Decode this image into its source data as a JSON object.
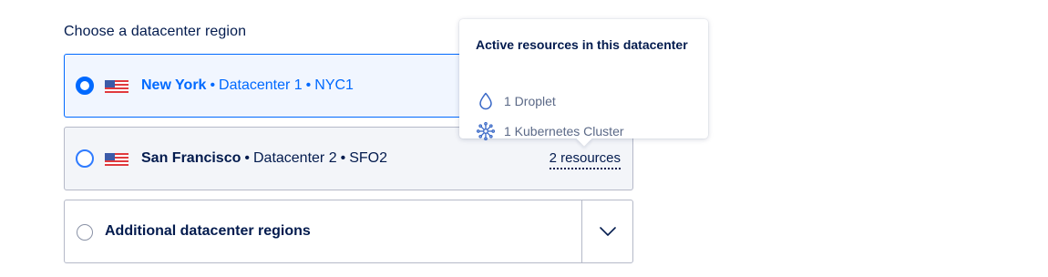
{
  "heading": "Choose a datacenter region",
  "regions": [
    {
      "city": "New York",
      "datacenter": "Datacenter 1",
      "code": "NYC1",
      "selected": true
    },
    {
      "city": "San Francisco",
      "datacenter": "Datacenter 2",
      "code": "SFO2",
      "selected": false,
      "resources_link": "2 resources"
    }
  ],
  "separator": "•",
  "additional": {
    "label": "Additional datacenter regions"
  },
  "tooltip": {
    "title": "Active resources in this datacenter",
    "items": [
      {
        "icon": "droplet-icon",
        "label": "1 Droplet"
      },
      {
        "icon": "kubernetes-icon",
        "label": "1 Kubernetes Cluster"
      }
    ]
  },
  "colors": {
    "accent": "#0069ff",
    "text": "#031b4e",
    "muted": "#5b6987",
    "border": "#b5b9c8"
  }
}
